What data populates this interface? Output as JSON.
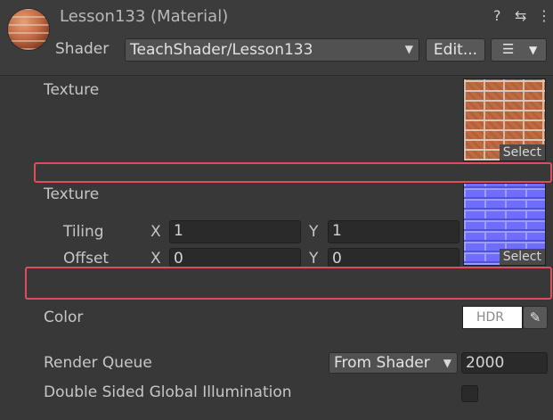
{
  "header": {
    "title": "Lesson133 (Material)",
    "help_icon": "?",
    "settings_icon": "⇆",
    "more_icon": "⋮",
    "shader_label": "Shader",
    "shader_value": "TeachShader/Lesson133",
    "edit_label": "Edit...",
    "list_icon": "☰"
  },
  "properties": {
    "texture1_label": "Texture",
    "texture1_select": "Select",
    "texture2_label": "Texture",
    "tiling_label": "Tiling",
    "offset_label": "Offset",
    "x_label": "X",
    "y_label": "Y",
    "tiling_x": "1",
    "tiling_y": "1",
    "offset_x": "0",
    "offset_y": "0",
    "texture2_select": "Select",
    "color_label": "Color",
    "color_hdr": "HDR",
    "color_value": "#ffffff"
  },
  "footer": {
    "render_queue_label": "Render Queue",
    "render_queue_mode": "From Shader",
    "render_queue_value": "2000",
    "dsgi_label": "Double Sided Global Illumination"
  },
  "colors": {
    "highlight": "#e24b5b",
    "background": "#383838"
  }
}
